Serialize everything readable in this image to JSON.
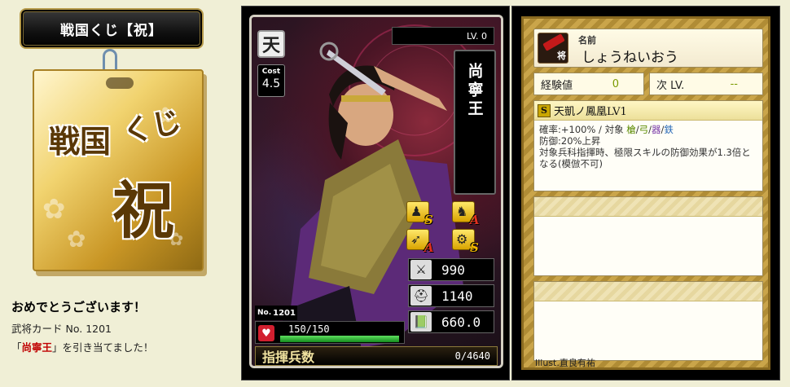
{
  "header": {
    "title": "戦国くじ【祝】"
  },
  "lottery_box": {
    "text_line1": "戦国",
    "text_line2": "くじ",
    "text_big": "祝"
  },
  "message": {
    "congrats": "おめでとうございます！",
    "card_number": "武将カード No. 1201",
    "result_prefix": "「",
    "result_name": "尚寧王",
    "result_suffix": "」を引き当てました！"
  },
  "card": {
    "rank": "天",
    "cost_label": "Cost",
    "cost_value": "4.5",
    "level": "LV. 0",
    "name": "尚寧王",
    "skills": [
      {
        "icon": "spear-soldier-icon",
        "grade": "S",
        "grade_color": "#f2b800"
      },
      {
        "icon": "horse-icon",
        "grade": "A",
        "grade_color": "#e03020"
      },
      {
        "icon": "bow-icon",
        "grade": "A",
        "grade_color": "#e03020"
      },
      {
        "icon": "siege-weapon-icon",
        "grade": "S",
        "grade_color": "#f2b800"
      }
    ],
    "stats": [
      {
        "icon": "sword-icon",
        "value": "990"
      },
      {
        "icon": "helmet-icon",
        "value": "1140"
      },
      {
        "icon": "book-icon",
        "value": "660.0"
      }
    ],
    "number_label": "No.",
    "number_value": "1201",
    "hp_text": "150/150",
    "hp_fraction": 1.0,
    "command_label": "指揮兵数",
    "command_value": "0/4640"
  },
  "info": {
    "name_label": "名前",
    "name_reading": "しょうねいおう",
    "general_tag": "将",
    "xp_label": "経験値",
    "xp_value": "0",
    "next_label": "次 LV.",
    "next_value": "--",
    "skill": {
      "grade": "S",
      "name": "天凱ノ鳳凰LV1",
      "line1_prefix": "確率:+100% / 対象 ",
      "target1": "槍",
      "target2": "弓",
      "target3": "器",
      "target4": "鉄",
      "line2": "防御:20%上昇",
      "line3": "対象兵科指揮時、極限スキルの防御効果が1.3倍となる(模倣不可)"
    },
    "illust_label": "Illust.",
    "illust_name": "直良有祐"
  },
  "colors": {
    "background": "#f0efd6",
    "result_highlight": "#c00000",
    "hp_green": "#138a1e"
  }
}
